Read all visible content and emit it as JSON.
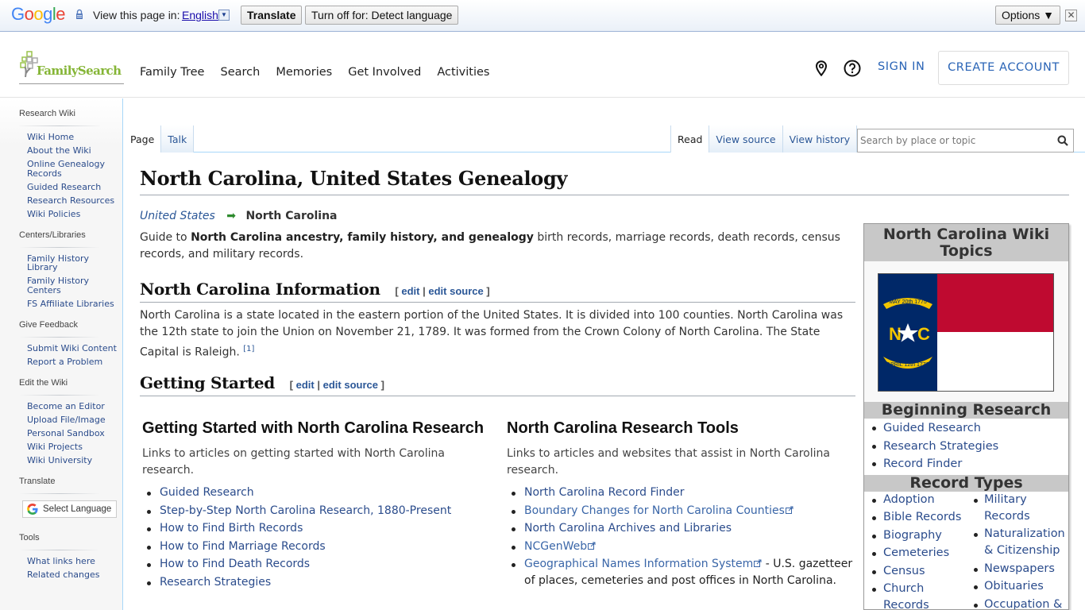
{
  "translate_bar": {
    "logo": "Google",
    "prompt": "View this page in:",
    "language": "English",
    "translate_label": "Translate",
    "turn_off_label": "Turn off for: Detect language",
    "options_label": "Options ▼",
    "close_glyph": "✕"
  },
  "header": {
    "logo_text": "FamilySearch",
    "nav": [
      "Family Tree",
      "Search",
      "Memories",
      "Get Involved",
      "Activities"
    ],
    "sign_in": "SIGN IN",
    "create_account": "CREATE ACCOUNT",
    "accent_color": "#2a64b6",
    "brand_color": "#85b536"
  },
  "sidebar": {
    "sections": [
      {
        "heading": "Research Wiki",
        "items": [
          "Wiki Home",
          "About the Wiki",
          "Online Genealogy Records",
          "Guided Research",
          "Research Resources",
          "Wiki Policies"
        ]
      },
      {
        "heading": "Centers/Libraries",
        "items": [
          "Family History Library",
          "Family History Centers",
          "FS Affiliate Libraries"
        ]
      },
      {
        "heading": "Give Feedback",
        "items": [
          "Submit Wiki Content",
          "Report a Problem"
        ]
      },
      {
        "heading": "Edit the Wiki",
        "items": [
          "Become an Editor",
          "Upload File/Image",
          "Personal Sandbox",
          "Wiki Projects",
          "Wiki University"
        ]
      },
      {
        "heading": "Translate",
        "select_language": "Select Language"
      },
      {
        "heading": "Tools",
        "items": [
          "What links here",
          "Related changes"
        ]
      }
    ]
  },
  "tabs": {
    "left": [
      {
        "label": "Page",
        "selected": true
      },
      {
        "label": "Talk",
        "selected": false
      }
    ],
    "right": [
      {
        "label": "Read",
        "selected": true
      },
      {
        "label": "View source",
        "selected": false
      },
      {
        "label": "View history",
        "selected": false
      }
    ],
    "search_placeholder": "Search by place or topic"
  },
  "article": {
    "title": "North Carolina, United States Genealogy",
    "breadcrumb": {
      "parent": "United States",
      "arrow": "➡",
      "current": "North Carolina"
    },
    "intro": {
      "prefix": "Guide to ",
      "bold": "North Carolina ancestry, family history, and genealogy",
      "suffix": " birth records, marriage records, death records, census records, and military records."
    },
    "sections": {
      "info": {
        "heading": "North Carolina Information",
        "edit": "edit",
        "edit_source": "edit source",
        "text": "North Carolina is a state located in the eastern portion of the United States. It is divided into 100 counties. North Carolina was the 12th state to join the Union on November 21, 1789. It was formed from the Crown Colony of North Carolina. The State Capital is Raleigh. ",
        "ref": "[1]"
      },
      "start": {
        "heading": "Getting Started",
        "edit": "edit",
        "edit_source": "edit source"
      }
    },
    "getting_started": {
      "title": "Getting Started with North Carolina Research",
      "desc": "Links to articles on getting started with North Carolina research.",
      "links": [
        "Guided Research",
        "Step-by-Step North Carolina Research, 1880-Present",
        "How to Find Birth Records",
        "How to Find Marriage Records",
        "How to Find Death Records",
        "Research Strategies"
      ]
    },
    "research_tools": {
      "title": "North Carolina Research Tools",
      "desc": "Links to articles and websites that assist in North Carolina research.",
      "links": [
        {
          "label": "North Carolina Record Finder",
          "external": false
        },
        {
          "label": "Boundary Changes for North Carolina Counties",
          "external": true
        },
        {
          "label": "North Carolina Archives and Libraries",
          "external": false
        },
        {
          "label": "NCGenWeb",
          "external": true
        },
        {
          "label": "Geographical Names Information System",
          "external": true,
          "note": " - U.S. gazetteer of places, cemeteries and post offices in North Carolina."
        }
      ]
    }
  },
  "infobox": {
    "title": "North Carolina Wiki Topics",
    "flag": {
      "alt": "North Carolina state flag",
      "banner_top": "MAY 20th 1775",
      "banner_bottom": "APRIL 12th 1776",
      "letters_left": "N",
      "letters_right": "C",
      "colors": {
        "blue": "#002868",
        "red": "#bf0a30",
        "gold": "#f2c500",
        "white": "#ffffff"
      }
    },
    "beginning_heading": "Beginning Research",
    "beginning": [
      "Guided Research",
      "Research Strategies",
      "Record Finder"
    ],
    "record_types_heading": "Record Types",
    "record_types_col1": [
      "Adoption",
      "Bible Records",
      "Biography",
      "Cemeteries",
      "Census",
      "Church Records"
    ],
    "record_types_col2": [
      "Military Records",
      "Naturalization & Citizenship",
      "Newspapers",
      "Obituaries",
      "Occupation &"
    ]
  }
}
